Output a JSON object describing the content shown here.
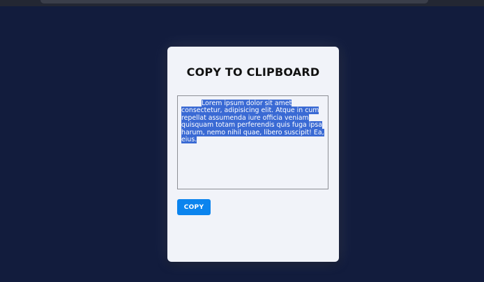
{
  "card": {
    "title": "COPY TO CLIPBOARD",
    "textarea_text": "Lorem ipsum dolor sit amet consectetur, adipisicing elit. Atque in cum repellat assumenda iure officia veniam quisquam totam perferendis quis fuga ipsa harum, nemo nihil quae, libero suscipit! Ea, eius.",
    "text_selected": true,
    "copy_label": "COPY"
  },
  "colors": {
    "page_background": "#121c3d",
    "card_background": "#f1f3f9",
    "button_background": "#0b84ee",
    "selection_highlight": "#3a6ad4"
  }
}
